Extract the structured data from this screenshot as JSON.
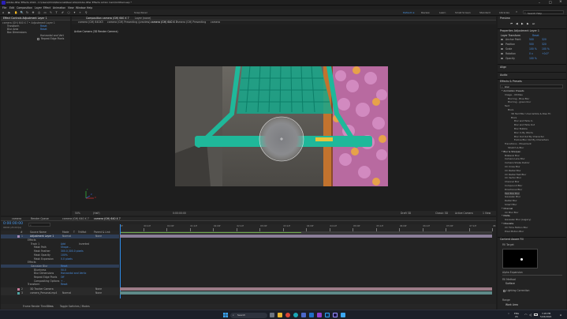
{
  "window": {
    "title": "Adobe After Effects 2024 - C:\\Users\\Chris\\Personal\\Real Life\\Adobe After Effects Action Cam\\Untitled.aep *",
    "controls": [
      "–",
      "□",
      "×"
    ]
  },
  "menu": [
    "File",
    "Edit",
    "Composition",
    "Layer",
    "Effect",
    "Animation",
    "View",
    "Window",
    "Help"
  ],
  "toolbar": {
    "view_label": "Snap Panel",
    "workspaces": [
      "Default",
      "Review",
      "Learn",
      "Small Screen",
      "Standard",
      "Libraries"
    ],
    "search_placeholder": "Search Help"
  },
  "left_panel": {
    "tabs": [
      "Effect Controls  Adjustment Layer 1",
      "≡"
    ],
    "breadcrumb": "camera (GH) 640 X 7 • Adjustment Layer 1",
    "effects": [
      {
        "name": "Transform",
        "value": "Reset"
      },
      {
        "name": "Blur Area",
        "value": "Reset"
      },
      {
        "name": "Box Dimensions",
        "value": ""
      },
      {
        "name": "",
        "value": "Horizontal and Vert"
      },
      {
        "name": "",
        "value": "Repeat Edge Pixels"
      }
    ]
  },
  "composition": {
    "tabs": [
      "Composition  camera (GH) 640 X 7",
      "Layer  (none)"
    ],
    "subtabs": [
      "camera (GH) 640X3",
      "camera (GH) Presenting (preview)",
      "camera (GH) 640 X 7",
      "camera (GH) Presenting",
      "camera"
    ],
    "camera_label": "Active Camera (3D Render Camera)",
    "footer": [
      "50%",
      "(Half)",
      "0:00:00:00",
      "Draft 3D",
      "Classic 3D",
      "Active Camera",
      "1 View"
    ],
    "axis_labels": [
      "Y",
      "X",
      "Z"
    ]
  },
  "right_panel": {
    "preview_label": "Preview",
    "properties_title": "Properties  Adjustment Layer 1",
    "layer_transform_label": "Layer Transform",
    "reset_label": "Reset",
    "transform_rows": [
      {
        "name": "Anchor Point",
        "v1": "500",
        "v2": "320"
      },
      {
        "name": "Position",
        "v1": "500",
        "v2": "320"
      },
      {
        "name": "Scale",
        "v1": "100 %",
        "v2": "100 %"
      },
      {
        "name": "Rotation",
        "v1": "0 x",
        "v2": "+0.0°"
      },
      {
        "name": "Opacity",
        "v1": "100 %",
        "v2": ""
      }
    ],
    "align_label": "Align",
    "audio_label": "Audio",
    "effects_presets_label": "Effects & Presets",
    "search_value": "blur",
    "tree": [
      "* Animation Presets",
      "  Image - Utilities",
      "    Blurring - Blue Blur",
      "    Blurring - green blur",
      "  Text",
      "    Blurs",
      "      3D Text Blur Unscramble & Rise TC",
      "      Blurs",
      "        Blur and Fade In",
      "        Blur and Fade Out",
      "        Blur Bubble",
      "        Blur In By Words",
      "        Blur Out Out By Character",
      "        Evolve Blur Out By Characters",
      "  Transitions - Movement",
      "    Stretch & Blur",
      "* Blur & Sharpen",
      "  Bilateral Blur",
      "  Camera Lens Blur",
      "  Camera Shake Deblur",
      "  CC Cross Blur",
      "  CC Radial Blur",
      "  CC Radial Fast Blur",
      "  CC Vector Blur",
      "  Channel Blur",
      "  Compound Blur",
      "  Directional Blur",
      "  Fast Box Blur",
      "  Gaussian Blur",
      "  Radial Blur",
      "  Smart Blur",
      "* Channel",
      "  CC Blur Blur",
      "* Matte",
      "  Gaussian Blur (Legacy)",
      "* Obsolete",
      "  CC Time Motion Blur",
      "  Pixel Motion Blur"
    ],
    "content_title": "Content Aware Fill",
    "content_labels": [
      "Fill Target",
      "Alpha Expansion",
      "Fill Method",
      "Surface",
      "Lighting Correction",
      "Range",
      "Work Area"
    ]
  },
  "timeline": {
    "tabs": [
      "camera",
      "Render Queue",
      "camera (GH) 640 X 7",
      "camera (GH) 640 X 7"
    ],
    "timecode": "0:00:00:00",
    "frame_info": "00000 (25.00 fps)",
    "columns": [
      "#",
      "Source Name",
      "Mode",
      "T",
      "TrkMat",
      "Parent & Link"
    ],
    "ruler": [
      "0f",
      "00:12f",
      "01:00f",
      "01:12f",
      "02:00f",
      "02:12f",
      "03:00f",
      "03:12f",
      "04:00f",
      "04:12f",
      "05:00f",
      "05:12f",
      "06:00f",
      "06:12f",
      "07:00f",
      "07:12f",
      "08:0"
    ],
    "layers": [
      {
        "num": "1",
        "name": "Adjustment Layer 1",
        "mode": "Normal",
        "parent": "None"
      },
      {
        "num": "2",
        "name": "3D Tracker Camera",
        "mode": "",
        "parent": "None"
      },
      {
        "num": "3",
        "name": "camera_Personal.mp4",
        "mode": "Normal",
        "parent": "None"
      }
    ],
    "props": [
      {
        "name": "Effects",
        "value": ""
      },
      {
        "name": "Track 1",
        "value": "Add",
        "extra": "Inverted"
      },
      {
        "name": "Mask Path",
        "value": "Shape..."
      },
      {
        "name": "Mask Feather",
        "value": "300.0,300.0 pixels"
      },
      {
        "name": "Mask Opacity",
        "value": "100%"
      },
      {
        "name": "Mask Expansion",
        "value": "0.0 pixels"
      },
      {
        "name": "Effects",
        "value": ""
      },
      {
        "name": "Gaussian Blur",
        "value": "Reset"
      },
      {
        "name": "Blurriness",
        "value": "50.0"
      },
      {
        "name": "Blur Dimensions",
        "value": "Horizontal and Vertic"
      },
      {
        "name": "Repeat Edge Pixels",
        "value": "Off"
      },
      {
        "name": "Compositing Options",
        "value": "+ -"
      },
      {
        "name": "Transform",
        "value": "Reset"
      }
    ],
    "footer": [
      "Frame Render Time",
      "Toggle Switches / Modes"
    ],
    "render_time": "30ms"
  },
  "taskbar": {
    "search_placeholder": "Search",
    "lang": "ENG",
    "region": "US",
    "time": "3:26 PM",
    "date": "5/24/2024"
  },
  "colors": {
    "accent": "#2d8ceb",
    "timeline_green": "#6ea84b",
    "layer_purple": "#a38ab3",
    "layer_pink": "#c77b99",
    "layer_teal": "#4fa7a5"
  }
}
